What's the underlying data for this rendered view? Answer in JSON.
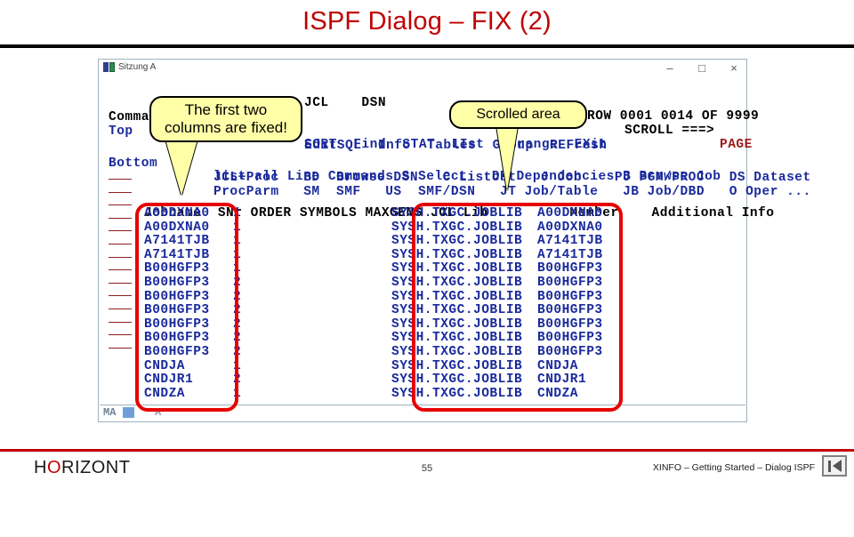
{
  "slide": {
    "title": "ISPF Dialog – FIX (2)"
  },
  "terminal": {
    "window_title": "Sitzung A",
    "window_buttons": {
      "minimize": "–",
      "maximize": "□",
      "close": "×"
    },
    "header": {
      "top_right_labels": "JCL    DSN",
      "row_indicator": "ROW 0001 0014 OF 9999",
      "scroll_label": "SCROLL ===>",
      "scroll_value": "PAGE",
      "command_prompt": "Command ===>",
      "top_label": "Top",
      "bottom_label": "Bottom"
    },
    "menu_rows": [
      "SORT  Find  STAT  LIst  Arrange  EXit",
      "EditSQL  Info  Tables  Group  REFresh",
      "list all Line Commands S Select   DP Dependencies B Browse Job",
      "JCL+Proc   BD  Browse DSN   C Listcat   J Job    PJ PGM/PROC   DS Dataset",
      "ProcParm   SM  SMF   US  SMF/DSN   JT Job/Table   JB Job/DBD   O Oper ..."
    ],
    "table": {
      "columns": [
        "Jobname",
        "SNr",
        "ORDER",
        "SYMBOLS",
        "MAXGENS",
        "JCL Lib",
        "Member",
        "Additional Info"
      ],
      "header_line": "Jobname  SNr ORDER SYMBOLS MAXGENS JCL Lib          Member    Additional Info",
      "rows": [
        {
          "jobname": "A00DXNA0",
          "snr": "1",
          "order": "",
          "symbols": "",
          "maxgens": "",
          "jcllib": "SYSH.TXGC.JOBLIB",
          "member": "A00DXNA0",
          "additional": ""
        },
        {
          "jobname": "A00DXNA0",
          "snr": "1",
          "order": "",
          "symbols": "",
          "maxgens": "",
          "jcllib": "SYSH.TXGC.JOBLIB",
          "member": "A00DXNA0",
          "additional": ""
        },
        {
          "jobname": "A7141TJB",
          "snr": "1",
          "order": "",
          "symbols": "",
          "maxgens": "",
          "jcllib": "SYSH.TXGC.JOBLIB",
          "member": "A7141TJB",
          "additional": ""
        },
        {
          "jobname": "A7141TJB",
          "snr": "1",
          "order": "",
          "symbols": "",
          "maxgens": "",
          "jcllib": "SYSH.TXGC.JOBLIB",
          "member": "A7141TJB",
          "additional": ""
        },
        {
          "jobname": "B00HGFP3",
          "snr": "1",
          "order": "",
          "symbols": "",
          "maxgens": "",
          "jcllib": "SYSH.TXGC.JOBLIB",
          "member": "B00HGFP3",
          "additional": ""
        },
        {
          "jobname": "B00HGFP3",
          "snr": "2",
          "order": "",
          "symbols": "",
          "maxgens": "",
          "jcllib": "SYSH.TXGC.JOBLIB",
          "member": "B00HGFP3",
          "additional": ""
        },
        {
          "jobname": "B00HGFP3",
          "snr": "2",
          "order": "",
          "symbols": "",
          "maxgens": "",
          "jcllib": "SYSH.TXGC.JOBLIB",
          "member": "B00HGFP3",
          "additional": ""
        },
        {
          "jobname": "B00HGFP3",
          "snr": "2",
          "order": "",
          "symbols": "",
          "maxgens": "",
          "jcllib": "SYSH.TXGC.JOBLIB",
          "member": "B00HGFP3",
          "additional": ""
        },
        {
          "jobname": "B00HGFP3",
          "snr": "2",
          "order": "",
          "symbols": "",
          "maxgens": "",
          "jcllib": "SYSH.TXGC.JOBLIB",
          "member": "B00HGFP3",
          "additional": ""
        },
        {
          "jobname": "B00HGFP3",
          "snr": "2",
          "order": "",
          "symbols": "",
          "maxgens": "",
          "jcllib": "SYSH.TXGC.JOBLIB",
          "member": "B00HGFP3",
          "additional": ""
        },
        {
          "jobname": "B00HGFP3",
          "snr": "2",
          "order": "",
          "symbols": "",
          "maxgens": "",
          "jcllib": "SYSH.TXGC.JOBLIB",
          "member": "B00HGFP3",
          "additional": ""
        },
        {
          "jobname": "CNDJA",
          "snr": "1",
          "order": "",
          "symbols": "",
          "maxgens": "",
          "jcllib": "SYSH.TXGC.JOBLIB",
          "member": "CNDJA",
          "additional": ""
        },
        {
          "jobname": "CNDJR1",
          "snr": "2",
          "order": "",
          "symbols": "",
          "maxgens": "",
          "jcllib": "SYSH.TXGC.JOBLIB",
          "member": "CNDJR1",
          "additional": ""
        },
        {
          "jobname": "CNDZA",
          "snr": "1",
          "order": "",
          "symbols": "",
          "maxgens": "",
          "jcllib": "SYSH.TXGC.JOBLIB",
          "member": "CNDZA",
          "additional": ""
        }
      ]
    },
    "status_bar": {
      "left": "MA",
      "indicator": "A"
    }
  },
  "callouts": {
    "fixed_columns": "The first two\ncolumns are fixed!",
    "scrolled_area": "Scrolled area"
  },
  "footer": {
    "logo_before": "H",
    "logo_o": "O",
    "logo_after": "RIZONT",
    "page_number": "55",
    "right_text": "XINFO – Getting Started – Dialog ISPF",
    "nav_button": "first-slide"
  },
  "colors": {
    "title_red": "#c00000",
    "highlight_red": "#e60000",
    "terminal_blue": "#1a2a9c",
    "callout_yellow": "#ffffa8"
  }
}
